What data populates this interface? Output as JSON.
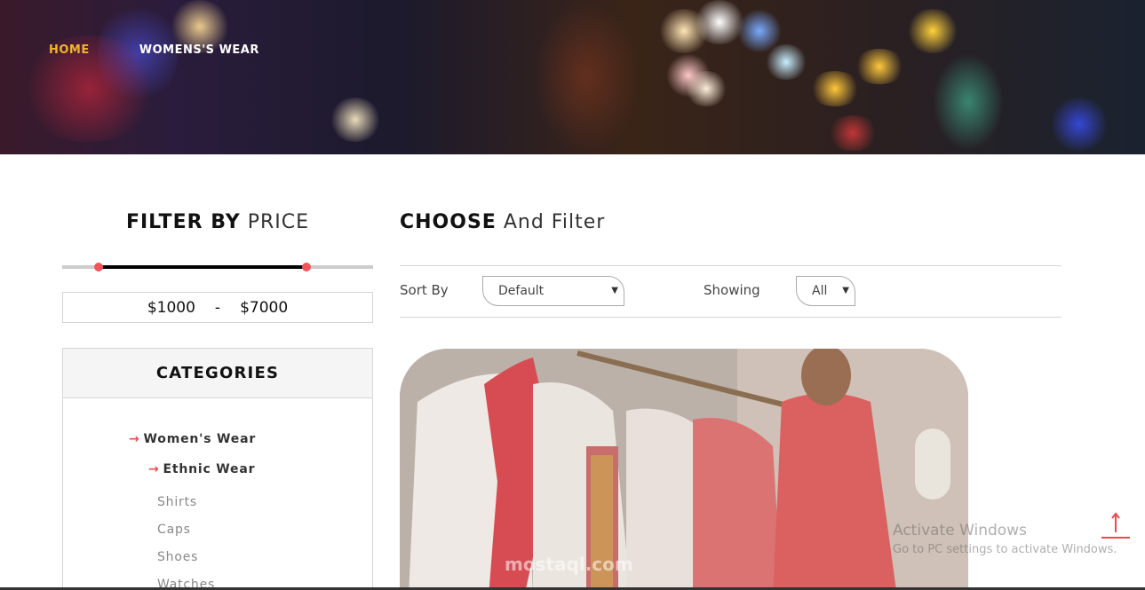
{
  "breadcrumb": {
    "home": "HOME",
    "current": "WOMENS'S WEAR"
  },
  "filter": {
    "title_bold": "FILTER BY",
    "title_light": "PRICE",
    "min_price": "$1000",
    "separator": "-",
    "max_price": "$7000",
    "min_value": 1000,
    "max_value": 7000,
    "accent_color": "#f0555a"
  },
  "categories": {
    "title": "CATEGORIES",
    "main": "Women's Wear",
    "sub": "Ethnic Wear",
    "items": [
      "Shirts",
      "Caps",
      "Shoes",
      "Watches"
    ],
    "arrow_icon": "right-arrow-icon",
    "arrow_color": "#e84c4f"
  },
  "main": {
    "title_bold": "CHOOSE",
    "title_light": "And Filter",
    "sort_label": "Sort By",
    "sort_value": "Default",
    "showing_label": "Showing",
    "showing_value": "All"
  },
  "overlay": {
    "watermark_brand": "mostaql.com",
    "windows_title": "Activate Windows",
    "windows_subtitle": "Go to PC settings to activate Windows."
  },
  "icons": {
    "scroll_top": "up-arrow-icon",
    "scroll_top_color": "#e84c4f",
    "breadcrumb_home_color": "#f0b52e"
  }
}
